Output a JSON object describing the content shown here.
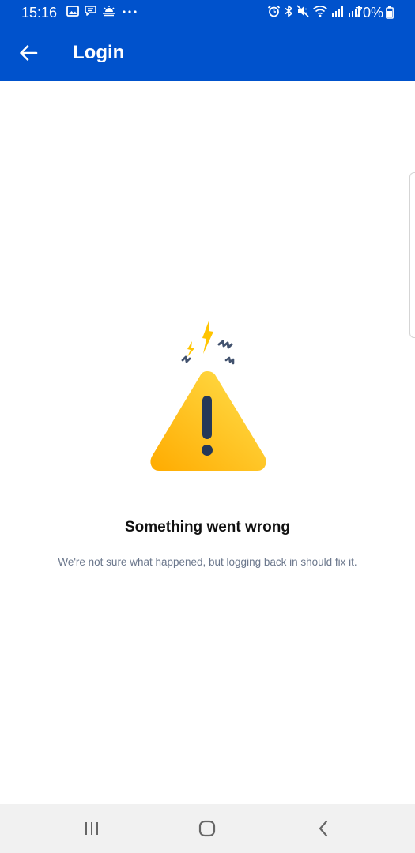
{
  "status_bar": {
    "time": "15:16",
    "battery": "70%",
    "left_icons": [
      "image-icon",
      "message-icon",
      "weather-icon",
      "more-dots-icon"
    ],
    "right_icons": [
      "alarm-icon",
      "bluetooth-icon",
      "mute-icon",
      "wifi-icon",
      "signal-icon",
      "signal-icon"
    ]
  },
  "app_bar": {
    "title": "Login",
    "back_icon": "arrow-left-icon",
    "background_color": "#0052CC"
  },
  "main": {
    "illustration": "warning-triangle-icon",
    "title": "Something went wrong",
    "message": "We're not sure what happened, but logging back in should fix it.",
    "accent_color": "#FFC400"
  },
  "nav_bar": {
    "buttons": [
      "recent-apps-icon",
      "home-icon",
      "back-icon"
    ]
  }
}
